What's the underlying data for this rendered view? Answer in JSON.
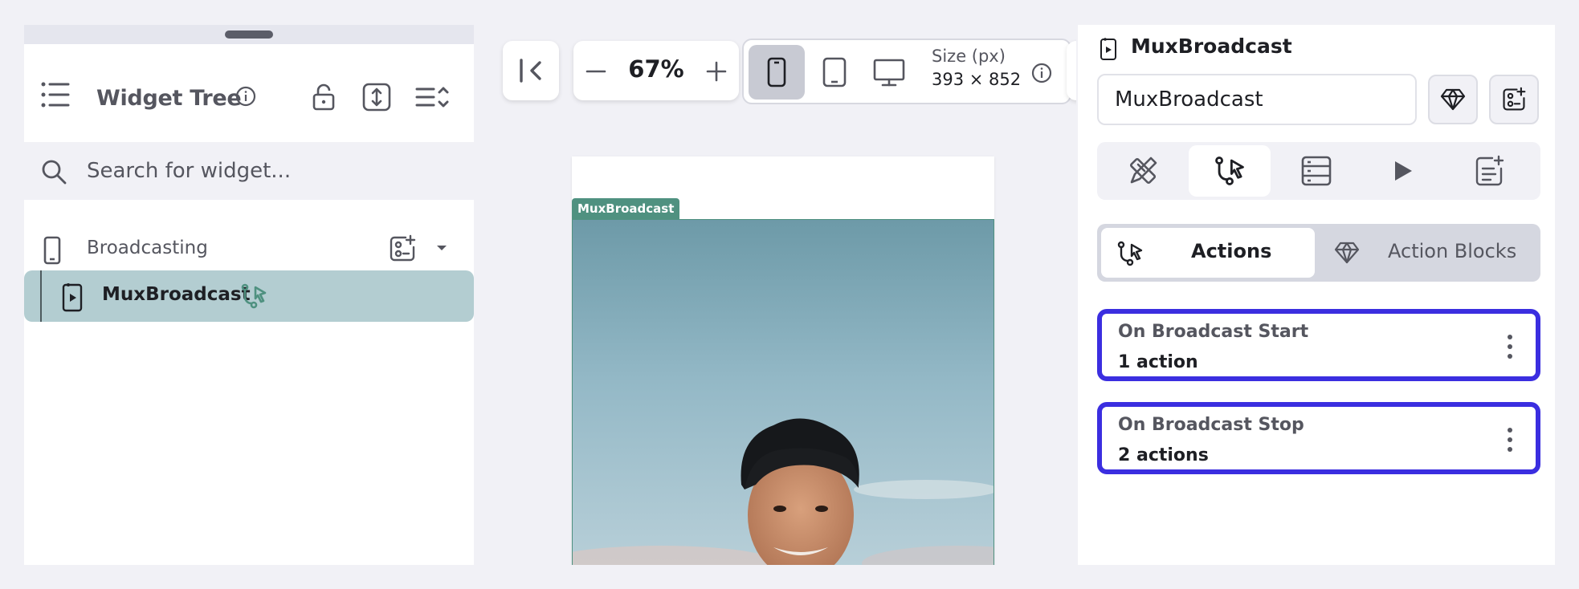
{
  "left_panel": {
    "title": "Widget Tree",
    "search": {
      "placeholder": "Search for widget..."
    },
    "tree": {
      "root": {
        "label": "Broadcasting",
        "icon": "phone-icon"
      },
      "selected": {
        "label": "MuxBroadcast",
        "icon": "video-widget-icon",
        "badge_icon": "action-flow-icon"
      }
    },
    "header_icons": [
      "list-tree-icon",
      "info-icon",
      "lock-icon",
      "expand-vertical-icon",
      "collapse-list-icon"
    ]
  },
  "canvas": {
    "zoom": "67%",
    "size_label": "Size (px)",
    "size_value": "393 × 852",
    "device_selected": "phone",
    "preview_tag": "MuxBroadcast"
  },
  "right_panel": {
    "widget_name": "MuxBroadcast",
    "name_field_value": "MuxBroadcast",
    "tabs": [
      "properties",
      "actions",
      "backend-query",
      "preview",
      "add-to-list"
    ],
    "active_tab": "actions",
    "segment": {
      "actions": "Actions",
      "action_blocks": "Action Blocks"
    },
    "action_items": [
      {
        "title": "On Broadcast Start",
        "count": "1 action"
      },
      {
        "title": "On Broadcast Stop",
        "count": "2 actions"
      }
    ]
  },
  "colors": {
    "accent_outline": "#3b2ee0",
    "selected_row": "#b3cdd1",
    "tag_green": "#4f9180"
  }
}
